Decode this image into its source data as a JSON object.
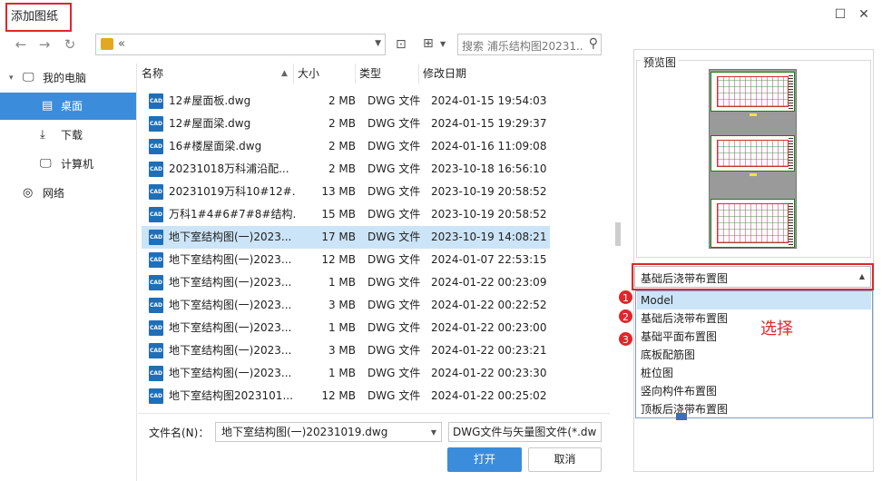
{
  "title": "添加图纸",
  "window": {
    "maximize_icon": "maximize-icon",
    "close_icon": "close-icon"
  },
  "nav": {
    "back_icon": "arrow-left-icon",
    "forward_icon": "arrow-right-icon",
    "refresh_icon": "refresh-icon",
    "address_text": "«",
    "search_placeholder": "搜索 浦乐结构图20231..."
  },
  "sidebar": {
    "items": [
      {
        "label": "我的电脑",
        "icon": "computer-icon",
        "expand": "▾"
      },
      {
        "label": "桌面",
        "icon": "desktop-icon"
      },
      {
        "label": "下载",
        "icon": "download-icon"
      },
      {
        "label": "计算机",
        "icon": "monitor-icon"
      },
      {
        "label": "网络",
        "icon": "network-icon"
      }
    ]
  },
  "columns": [
    "名称",
    "大小",
    "类型",
    "修改日期"
  ],
  "files": [
    {
      "name": "12#屋面板.dwg",
      "size": "2 MB",
      "type": "DWG 文件",
      "date": "2024-01-15 19:54:03"
    },
    {
      "name": "12#屋面梁.dwg",
      "size": "2 MB",
      "type": "DWG 文件",
      "date": "2024-01-15 19:29:37"
    },
    {
      "name": "16#楼屋面梁.dwg",
      "size": "2 MB",
      "type": "DWG 文件",
      "date": "2024-01-16 11:09:08"
    },
    {
      "name": "20231018万科浦沿配...",
      "size": "2 MB",
      "type": "DWG 文件",
      "date": "2023-10-18 16:56:10"
    },
    {
      "name": "20231019万科10#12#...",
      "size": "13 MB",
      "type": "DWG 文件",
      "date": "2023-10-19 20:58:52"
    },
    {
      "name": "万科1#4#6#7#8#结构...",
      "size": "15 MB",
      "type": "DWG 文件",
      "date": "2023-10-19 20:58:52"
    },
    {
      "name": "地下室结构图(一)2023...",
      "size": "17 MB",
      "type": "DWG 文件",
      "date": "2023-10-19 14:08:21"
    },
    {
      "name": "地下室结构图(一)2023...",
      "size": "12 MB",
      "type": "DWG 文件",
      "date": "2024-01-07 22:53:15"
    },
    {
      "name": "地下室结构图(一)2023...",
      "size": "1 MB",
      "type": "DWG 文件",
      "date": "2024-01-22 00:23:09"
    },
    {
      "name": "地下室结构图(一)2023...",
      "size": "3 MB",
      "type": "DWG 文件",
      "date": "2024-01-22 00:22:52"
    },
    {
      "name": "地下室结构图(一)2023...",
      "size": "1 MB",
      "type": "DWG 文件",
      "date": "2024-01-22 00:23:00"
    },
    {
      "name": "地下室结构图(一)2023...",
      "size": "3 MB",
      "type": "DWG 文件",
      "date": "2024-01-22 00:23:21"
    },
    {
      "name": "地下室结构图(一)2023...",
      "size": "1 MB",
      "type": "DWG 文件",
      "date": "2024-01-22 00:23:30"
    },
    {
      "name": "地下室结构图2023101...",
      "size": "12 MB",
      "type": "DWG 文件",
      "date": "2024-01-22 00:25:02"
    }
  ],
  "file_icon_label": "CAD",
  "footer": {
    "filename_label": "文件名(N)：",
    "filename_value": "地下室结构图(一)20231019.dwg",
    "filetype_value": "DWG文件与矢量图文件(*.dw",
    "open_label": "打开",
    "cancel_label": "取消"
  },
  "preview": {
    "label": "预览图"
  },
  "layout": {
    "selected": "基础后浇带布置图",
    "options": [
      "Model",
      "基础后浇带布置图",
      "基础平面布置图",
      "底板配筋图",
      "桩位图",
      "竖向构件布置图",
      "顶板后浇带布置图"
    ],
    "badges": [
      "1",
      "2",
      "3"
    ],
    "choose_label": "选择"
  },
  "colors": {
    "accent": "#3b8cdb",
    "highlight_red": "#e0262a",
    "selected_row": "#cce4f7"
  }
}
